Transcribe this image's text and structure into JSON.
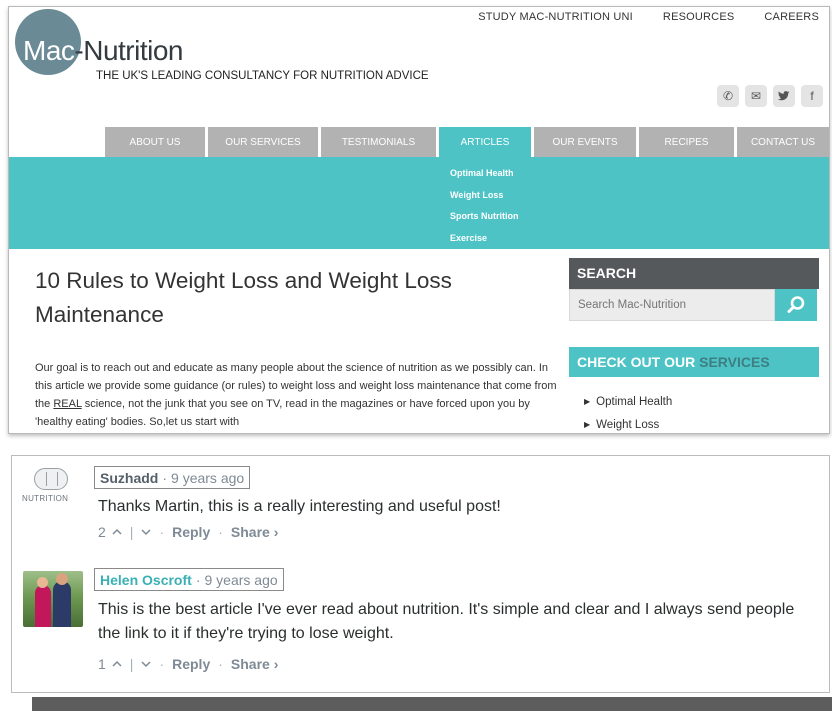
{
  "site": {
    "top_nav": [
      "STUDY MAC-NUTRITION UNI",
      "RESOURCES",
      "CAREERS"
    ],
    "logo_prefix": "Mac",
    "logo_suffix": "-Nutrition",
    "tagline": "THE UK'S LEADING CONSULTANCY FOR NUTRITION ADVICE",
    "social_icons": [
      "phone-icon",
      "email-icon",
      "twitter-icon",
      "facebook-icon"
    ],
    "social_glyphs": [
      "✆",
      "✉",
      "🐦",
      "f"
    ],
    "main_nav": [
      "ABOUT US",
      "OUR SERVICES",
      "TESTIMONIALS",
      "ARTICLES",
      "OUR EVENTS",
      "RECIPES",
      "CONTACT US"
    ],
    "active_nav": "ARTICLES",
    "dropdown": [
      "Optimal Health",
      "Weight Loss",
      "Sports Nutrition",
      "Exercise"
    ],
    "article_title": "10 Rules to Weight Loss and Weight Loss Maintenance",
    "article_body_1": "Our goal is to reach out and educate as many people about the science of nutrition as we possibly can. In this article we provide some guidance (or rules) to weight loss and weight loss maintenance that come from the ",
    "article_body_link": "REAL",
    "article_body_2": " science, not the junk that you see on TV, read in the magazines or have forced upon you by 'healthy eating' bodies. So,let us start with",
    "search_title": "SEARCH",
    "search_placeholder": "Search Mac-Nutrition",
    "services_title_1": "CHECK OUT OUR ",
    "services_title_2": "SERVICES",
    "services": [
      "Optimal Health",
      "Weight Loss"
    ],
    "colors": {
      "teal": "#4ec3c6",
      "nav_grey": "#b2b2b2",
      "dark_header": "#56595c"
    }
  },
  "comments": [
    {
      "author": "Suzhadd",
      "dot": "·",
      "time": "9 years ago",
      "avatar_brand": "NUTRITION",
      "text": "Thanks Martin, this is a really interesting and useful post!",
      "votes": "2",
      "reply": "Reply",
      "share": "Share ›"
    },
    {
      "author": "Helen Oscroft",
      "dot": "·",
      "time": "9 years ago",
      "text": "This is the best article I've ever read about nutrition. It's simple and clear and I always send people the link to it if they're trying to lose weight.",
      "votes": "1",
      "reply": "Reply",
      "share": "Share ›"
    }
  ]
}
